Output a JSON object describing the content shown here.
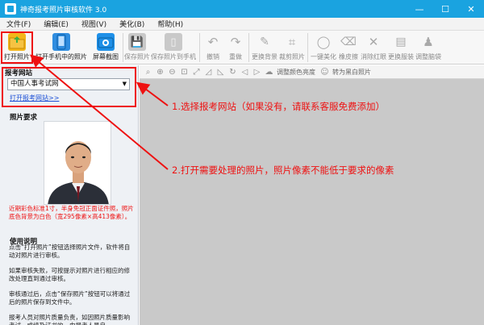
{
  "window": {
    "title": "神奇报考照片审核软件 3.0",
    "minimize": "—",
    "maximize": "☐",
    "close": "✕"
  },
  "menu": [
    "文件(F)",
    "编辑(E)",
    "视图(V)",
    "美化(B)",
    "帮助(H)"
  ],
  "toolbar": {
    "open_photo": "打开照片",
    "open_phone": "打开手机中的照片",
    "screenshot": "屏幕截图",
    "save_photo": "保存照片",
    "save_to_phone": "保存照片到手机",
    "undo": "撤销",
    "redo": "重做",
    "change_bg": "更换背景",
    "crop": "裁剪照片",
    "beautify": "一键美化",
    "eraser": "橡皮擦",
    "remove_redeye": "消除红眼",
    "change_clothes": "更换服装",
    "adjust_head": "调整脑袋"
  },
  "left": {
    "site_title": "报考网站",
    "site_value": "中国人事考试网",
    "site_link": "打开报考网站>>",
    "req_title": "照片要求",
    "req_text": "近期彩色标准1寸，半身免冠正面证件照，照片底色背景为白色（宽295像素×高413像素）。",
    "usage_title": "使用说明",
    "usage_1": "点击“打开照片”按钮选择照片文件，软件将自动对照片进行审核。",
    "usage_2": "如果审核失败，可按提示对照片进行相应的修改处理直到通过审核。",
    "usage_3": "审核通过后，点击“保存照片”按钮可以将通过后的照片保存到文件中。",
    "usage_4": "报考人员对照片质量负责，如因照片质量影响考试、成绩及证书的，由报考人员自"
  },
  "work_toolbar": {
    "adjust_color": "调整颜色亮度",
    "to_bw": "转为黑白照片"
  },
  "annotations": {
    "note1": "1.选择报考网站（如果没有，请联系客服免费添加）",
    "note2": "2.打开需要处理的照片，照片像素不能低于要求的像素"
  },
  "colors": {
    "titlebar": "#1aa3e0",
    "annotation": "#e11111",
    "link": "#1a4fd6",
    "workarea": "#c9c9c9"
  }
}
